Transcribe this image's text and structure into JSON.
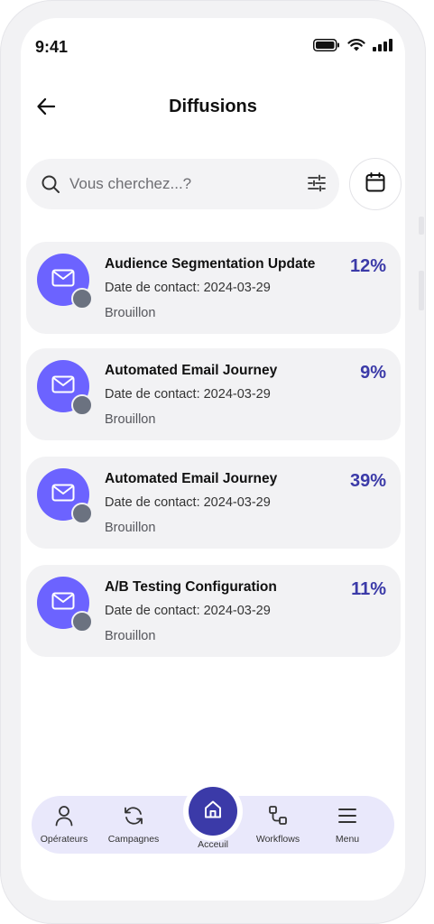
{
  "status_bar": {
    "time": "9:41"
  },
  "header": {
    "title": "Diffusions"
  },
  "search": {
    "placeholder": "Vous cherchez...?"
  },
  "cards": [
    {
      "title": "Audience Segmentation Update",
      "date": "Date de contact: 2024-03-29",
      "status": "Brouillon",
      "percent": "12%"
    },
    {
      "title": "Automated Email Journey",
      "date": "Date de contact: 2024-03-29",
      "status": "Brouillon",
      "percent": "9%"
    },
    {
      "title": "Automated Email Journey",
      "date": "Date de contact: 2024-03-29",
      "status": "Brouillon",
      "percent": "39%"
    },
    {
      "title": "A/B Testing Configuration",
      "date": "Date de contact: 2024-03-29",
      "status": "Brouillon",
      "percent": "11%"
    }
  ],
  "nav": {
    "operators": "Opérateurs",
    "campaigns": "Campagnes",
    "home": "Acceuil",
    "workflows": "Workflows",
    "menu": "Menu"
  },
  "colors": {
    "accent": "#3b3aa8",
    "avatar": "#6c63ff",
    "card_bg": "#f2f2f4",
    "nav_bg": "#e9e8fb"
  },
  "icons": {
    "back": "arrow-left-icon",
    "search": "search-icon",
    "filter": "sliders-icon",
    "calendar": "calendar-icon",
    "avatar": "mail-icon",
    "operators": "user-icon",
    "campaigns": "refresh-icon",
    "home": "home-icon",
    "workflows": "workflow-icon",
    "menu": "hamburger-icon"
  }
}
